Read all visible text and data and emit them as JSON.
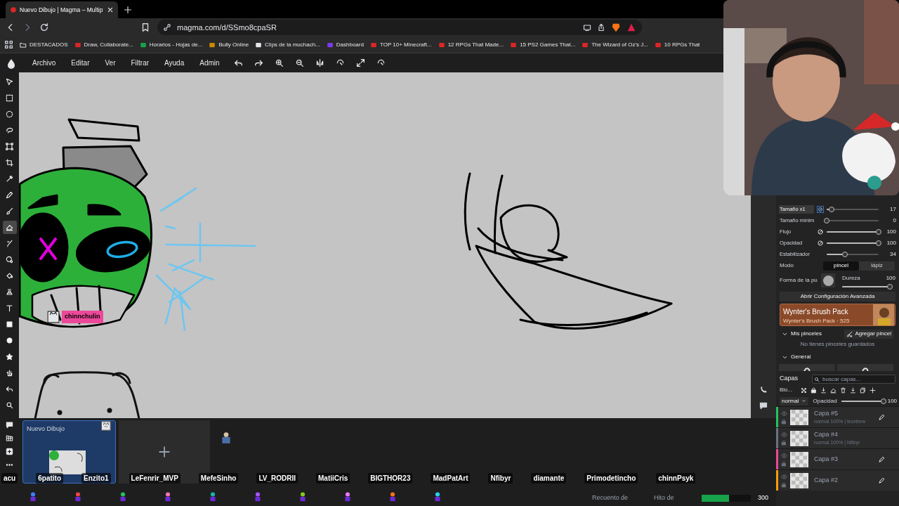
{
  "browser": {
    "tab": {
      "title": "Nuevo Dibujo | Magma – Multip",
      "selected": true
    },
    "address": "magma.com/d/SSmo8cpaSR",
    "bookmarks": [
      "DESTACADOS",
      "Draw, Collaborate...",
      "Horarios - Hojas de...",
      "Bully Online",
      "Clips de la muchach...",
      "Dashboard",
      "TOP 10+ Minecraft...",
      "12 RPGs That Made...",
      "15 PS2 Games That...",
      "The Wizard of Oz's J...",
      "10 RPGs That"
    ]
  },
  "app": {
    "menu": [
      "Archivo",
      "Editar",
      "Ver",
      "Filtrar",
      "Ayuda",
      "Admin"
    ]
  },
  "tools": [
    {
      "kind": "move",
      "selected": false
    },
    {
      "kind": "rect",
      "selected": false
    },
    {
      "kind": "ellipse",
      "selected": false
    },
    {
      "kind": "lasso",
      "selected": false
    },
    {
      "kind": "transform",
      "selected": false
    },
    {
      "kind": "crop",
      "selected": false
    },
    {
      "kind": "picker",
      "selected": false
    },
    {
      "kind": "pencil",
      "selected": false
    },
    {
      "kind": "brush",
      "selected": false
    },
    {
      "kind": "eraser",
      "selected": true
    },
    {
      "kind": "smudge",
      "selected": false
    },
    {
      "kind": "blur",
      "selected": false
    },
    {
      "kind": "fill",
      "selected": false
    },
    {
      "kind": "stamp",
      "selected": false
    },
    {
      "kind": "text",
      "selected": false
    },
    {
      "kind": "square",
      "selected": false
    },
    {
      "kind": "circle",
      "selected": false
    },
    {
      "kind": "star",
      "selected": false
    },
    {
      "kind": "hand",
      "selected": false
    },
    {
      "kind": "undo",
      "selected": false
    },
    {
      "kind": "zoom",
      "selected": false
    },
    {
      "kind": "chat",
      "selected": false
    },
    {
      "kind": "grid",
      "selected": false
    },
    {
      "kind": "add",
      "selected": false
    },
    {
      "kind": "more",
      "selected": false
    }
  ],
  "cursor_label": "chinnchulin",
  "brush": {
    "settings": [
      {
        "label": "Tamaño x1",
        "value": "17",
        "level": 0.1,
        "pressure": true,
        "highlight": true
      },
      {
        "label": "Tamaño mínim",
        "value": "0",
        "level": 0,
        "pressure": false,
        "highlight": false
      },
      {
        "label": "Flujo",
        "value": "100",
        "level": 1,
        "pressure": true,
        "highlight": false
      },
      {
        "label": "Opacidad",
        "value": "100",
        "level": 1,
        "pressure": true,
        "highlight": false
      },
      {
        "label": "Estabilizador",
        "value": "34",
        "level": 0.35,
        "pressure": false,
        "highlight": false
      }
    ],
    "mode_label": "Modo",
    "modes": [
      {
        "label": "pincel",
        "selected": true
      },
      {
        "label": "lápiz",
        "selected": false
      }
    ],
    "shape_label": "Forma de la pu",
    "hardness_label": "Dureza",
    "hardness_value": "100",
    "hardness": {
      "level": 1
    },
    "advanced_button": "Abrir Configuración Avanzada",
    "promo": {
      "title": "Wynter's Brush Pack",
      "subtitle": "Wynter's Brush Pack · 525"
    },
    "my_brushes": {
      "label": "Mis pinceles",
      "expanded": true,
      "add_button": "Agregar pincel",
      "empty": "No tienes pinceles guardados"
    },
    "general": {
      "label": "General",
      "expanded": true
    }
  },
  "layers": {
    "title": "Capas",
    "search_placeholder": "buscar capas...",
    "blend_label": "Blo...",
    "blend_mode": "normal",
    "opacity_label": "Opacidad",
    "opacity_value": "100",
    "opacity": {
      "level": 1
    },
    "items": [
      {
        "name": "Capa #5",
        "info": "normal 100% | leoxtrew",
        "color": "#22c55e",
        "editing": true
      },
      {
        "name": "Capa #4",
        "info": "normal 100% | Nfibyr",
        "color": "#6b7280",
        "editing": false
      },
      {
        "name": "Capa #3",
        "color": "#ec4899",
        "editing": true
      },
      {
        "name": "Capa #2",
        "color": "#f59e0b",
        "editing": true
      }
    ]
  },
  "files": [
    {
      "title": "Nuevo Dibujo",
      "selected": true
    }
  ],
  "users": [
    "acu",
    "6patito",
    "Enzito1",
    "LeFenrir_MVP",
    "MefeSinho",
    "LV_RODRII",
    "MatiiCris",
    "BIGTHOR23",
    "MadPatArt",
    "Nfibyr",
    "diamante",
    "Primodetincho",
    "chinnPsyk"
  ],
  "status": {
    "strokes_label": "Recuento de",
    "milestone_label": "Hito de",
    "milestone": {
      "level": 0.55
    },
    "milestone_value": "300"
  }
}
